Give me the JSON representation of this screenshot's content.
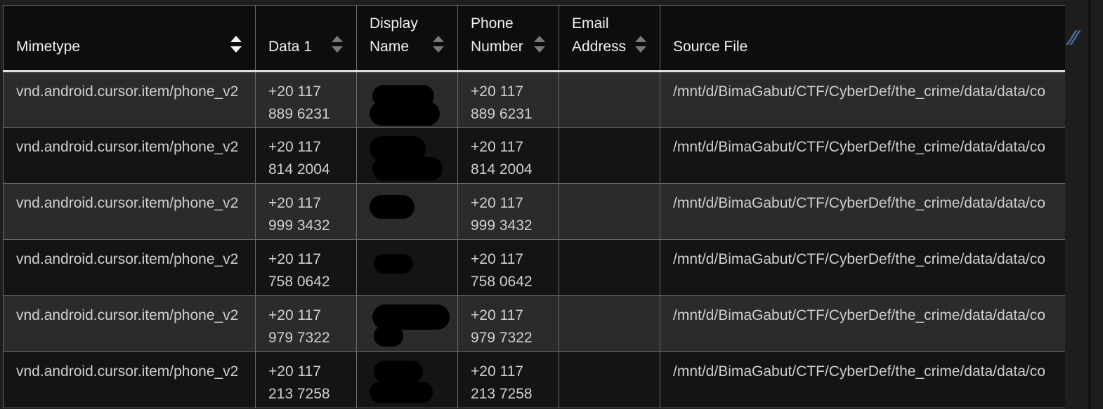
{
  "table": {
    "columns": [
      {
        "key": "mimetype",
        "label": "Mimetype",
        "sort_active": true
      },
      {
        "key": "data1",
        "label": "Data 1",
        "sort_active": false
      },
      {
        "key": "display_name",
        "label": "Display Name",
        "sort_active": false
      },
      {
        "key": "phone_number",
        "label": "Phone Number",
        "sort_active": false
      },
      {
        "key": "email_address",
        "label": "Email Address",
        "sort_active": false
      },
      {
        "key": "source_file",
        "label": "Source File",
        "sort_active": false
      }
    ],
    "rows": [
      {
        "mimetype": "vnd.android.cursor.item/phone_v2",
        "data1": "+20 117 889 6231",
        "display_name": "",
        "phone_number": "+20 117 889 6231",
        "email_address": "",
        "source_file": "/mnt/d/BimaGabut/CTF/CyberDef/the_crime/data/data/co"
      },
      {
        "mimetype": "vnd.android.cursor.item/phone_v2",
        "data1": "+20 117 814 2004",
        "display_name": "",
        "phone_number": "+20 117 814 2004",
        "email_address": "",
        "source_file": "/mnt/d/BimaGabut/CTF/CyberDef/the_crime/data/data/co"
      },
      {
        "mimetype": "vnd.android.cursor.item/phone_v2",
        "data1": "+20 117 999 3432",
        "display_name": "",
        "phone_number": "+20 117 999 3432",
        "email_address": "",
        "source_file": "/mnt/d/BimaGabut/CTF/CyberDef/the_crime/data/data/co"
      },
      {
        "mimetype": "vnd.android.cursor.item/phone_v2",
        "data1": "+20 117 758 0642",
        "display_name": "",
        "phone_number": "+20 117 758 0642",
        "email_address": "",
        "source_file": "/mnt/d/BimaGabut/CTF/CyberDef/the_crime/data/data/co"
      },
      {
        "mimetype": "vnd.android.cursor.item/phone_v2",
        "data1": "+20 117 979 7322",
        "display_name": "",
        "phone_number": "+20 117 979 7322",
        "email_address": "",
        "source_file": "/mnt/d/BimaGabut/CTF/CyberDef/the_crime/data/data/co"
      },
      {
        "mimetype": "vnd.android.cursor.item/phone_v2",
        "data1": "+20 117 213 7258",
        "display_name": "",
        "phone_number": "+20 117 213 7258",
        "email_address": "",
        "source_file": "/mnt/d/BimaGabut/CTF/CyberDef/the_crime/data/data/co"
      }
    ]
  },
  "colors": {
    "header_bg": "#0d0d0d",
    "row_odd": "#2b2b2b",
    "row_even": "#141414",
    "redaction": "#000000"
  },
  "icons": {
    "sort": "sort-arrows-icon",
    "side": "pen-icon"
  }
}
